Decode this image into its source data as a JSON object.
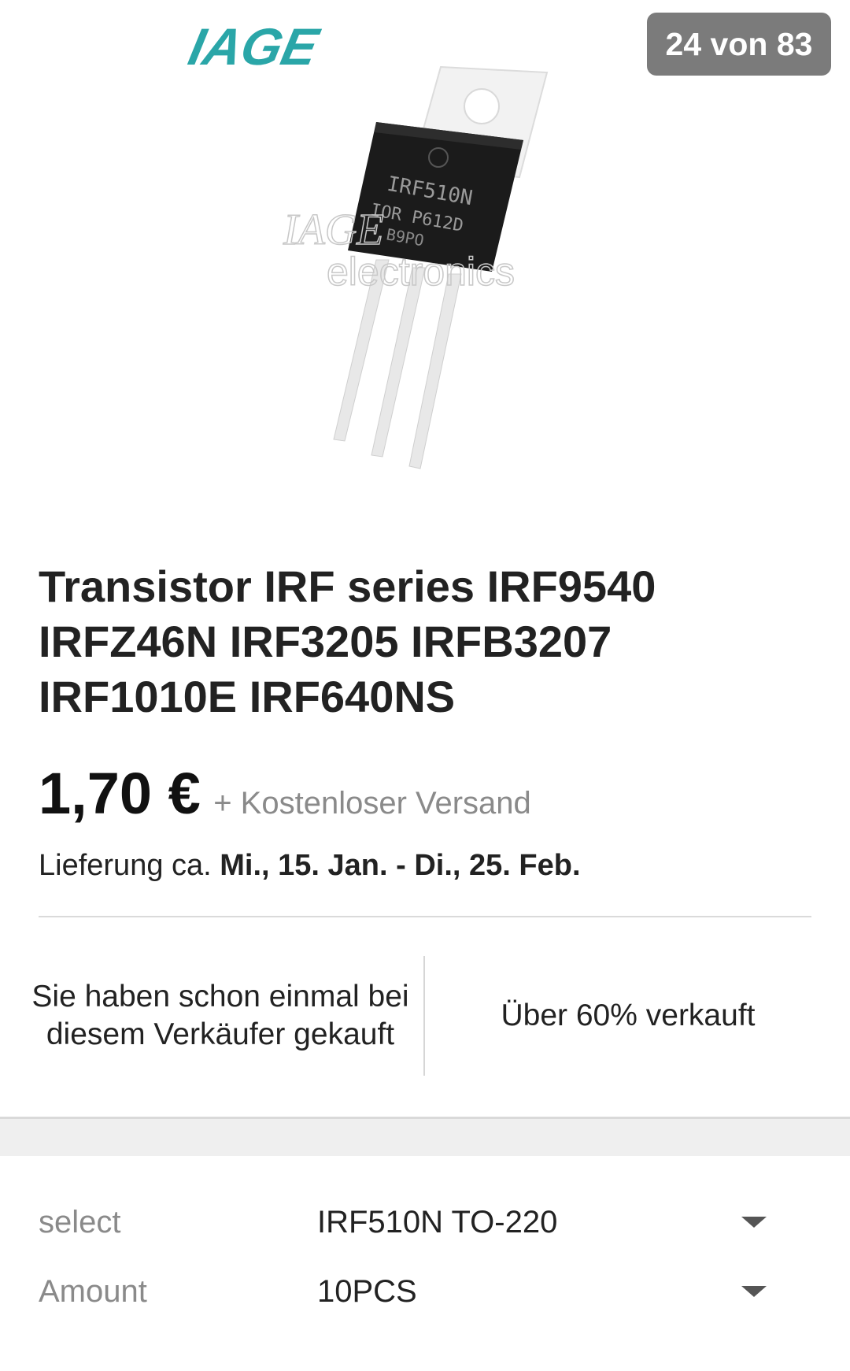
{
  "gallery": {
    "counter": "24 von 83",
    "brand_logo": "IAGE",
    "chip_line1": "IRF510N",
    "chip_line2": "IOR P612D",
    "chip_line3": "B9PO",
    "watermark_top": "IAGE",
    "watermark_bottom": "electronics",
    "brand_color": "#2aa6a8"
  },
  "product": {
    "title": "Transistor IRF series IRF9540 IRFZ46N IRF3205 IRFB3207 IRF1010E IRF640NS",
    "price": "1,70 €",
    "shipping": "+ Kostenloser Versand",
    "delivery_prefix": "Lieferung ca. ",
    "delivery_dates": "Mi., 15. Jan. - Di., 25. Feb."
  },
  "info": {
    "left": "Sie haben schon einmal bei diesem Verkäufer gekauft",
    "right": "Über 60% verkauft"
  },
  "options": [
    {
      "label": "select",
      "value": "IRF510N TO-220",
      "icon": "chevron-down-icon"
    },
    {
      "label": "Amount",
      "value": "10PCS",
      "icon": "chevron-down-icon"
    }
  ]
}
